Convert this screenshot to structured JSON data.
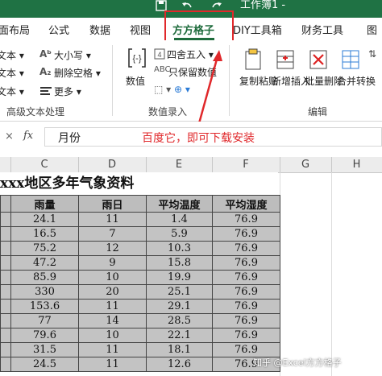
{
  "window": {
    "title": "工作簿1 -"
  },
  "tabs": [
    {
      "label": "面布局"
    },
    {
      "label": "公式"
    },
    {
      "label": "数据"
    },
    {
      "label": "视图"
    },
    {
      "label": "方方格子",
      "active": true
    },
    {
      "label": "DIY工具箱"
    },
    {
      "label": "财务工具"
    },
    {
      "label": "图"
    }
  ],
  "ribbon": {
    "text_group": {
      "items": [
        "文本 ▾",
        "文本 ▾",
        "文本 ▾",
        "大小写 ▾",
        "删除空格 ▾",
        "更多 ▾"
      ],
      "label": "高级文本处理"
    },
    "number_group": {
      "numeric_label": "数值",
      "rounding_label": "四舍五入 ▾",
      "keep_value_label": "只保留数值",
      "label": "数值录入"
    },
    "edit_group": {
      "buttons": [
        "复制粘贴",
        "新增插入",
        "批量删除",
        "合并转换"
      ],
      "label": "编辑"
    },
    "accent_color": "#1e6b3c",
    "highlight_color": "#e0282b"
  },
  "formula_bar": {
    "cancel": "×",
    "fx": "fx",
    "value": "月份",
    "annotation": "百度它，即可下载安装"
  },
  "sheet": {
    "columns": [
      "C",
      "D",
      "E",
      "F",
      "G",
      "H"
    ],
    "title": "xxx地区多年气象资料",
    "headers": [
      "",
      "雨量",
      "雨日",
      "平均温度",
      "平均湿度"
    ],
    "rows": [
      [
        "",
        "24.1",
        "11",
        "1.4",
        "76.9"
      ],
      [
        "",
        "16.5",
        "7",
        "5.9",
        "76.9"
      ],
      [
        "",
        "75.2",
        "12",
        "10.3",
        "76.9"
      ],
      [
        "",
        "47.2",
        "9",
        "15.8",
        "76.9"
      ],
      [
        "",
        "85.9",
        "10",
        "19.9",
        "76.9"
      ],
      [
        "",
        "330",
        "20",
        "25.1",
        "76.9"
      ],
      [
        "",
        "153.6",
        "11",
        "29.1",
        "76.9"
      ],
      [
        "",
        "77",
        "14",
        "28.5",
        "76.9"
      ],
      [
        "",
        "79.6",
        "10",
        "22.1",
        "76.9"
      ],
      [
        "",
        "31.5",
        "11",
        "18.1",
        "76.9"
      ],
      [
        "",
        "24.5",
        "11",
        "12.6",
        "76.9"
      ]
    ]
  },
  "watermark": "知乎 @Excel方方格子"
}
